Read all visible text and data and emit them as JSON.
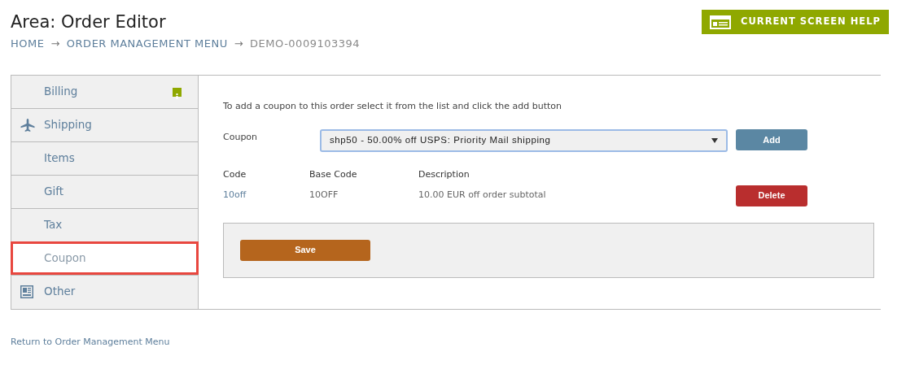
{
  "page": {
    "title": "Area: Order Editor"
  },
  "breadcrumb": [
    {
      "kind": "link",
      "label": "HOME"
    },
    {
      "kind": "separator",
      "label": "→"
    },
    {
      "kind": "link",
      "label": "ORDER MANAGEMENT MENU"
    },
    {
      "kind": "separator",
      "label": "→"
    },
    {
      "kind": "current",
      "label": "DEMO-0009103394"
    }
  ],
  "help_button": {
    "label": "CURRENT SCREEN HELP"
  },
  "sidebar": {
    "items": [
      {
        "label": "Billing",
        "kind": "plain",
        "alert": true,
        "selected": false
      },
      {
        "label": "Shipping",
        "kind": "plane",
        "alert": false,
        "selected": false
      },
      {
        "label": "Items",
        "kind": "plain",
        "alert": false,
        "selected": false
      },
      {
        "label": "Gift",
        "kind": "plain",
        "alert": false,
        "selected": false
      },
      {
        "label": "Tax",
        "kind": "plain",
        "alert": false,
        "selected": false
      },
      {
        "label": "Coupon",
        "kind": "plain",
        "alert": false,
        "selected": true
      },
      {
        "label": "Other",
        "kind": "form",
        "alert": false,
        "selected": false
      }
    ]
  },
  "coupon_form": {
    "instructions": "To add a coupon to this order select it from the list and click the add button",
    "field_label": "Coupon",
    "select_value": "shp50 - 50.00% off USPS: Priority Mail shipping",
    "add_button": "Add"
  },
  "table": {
    "columns": [
      "Code",
      "Base Code",
      "Description"
    ],
    "rows": [
      {
        "cells": [
          "10off",
          "10OFF",
          "10.00 EUR off order subtotal"
        ],
        "action": "Delete"
      }
    ]
  },
  "save_button": "Save",
  "footer_link": "Return to Order Management Menu"
}
